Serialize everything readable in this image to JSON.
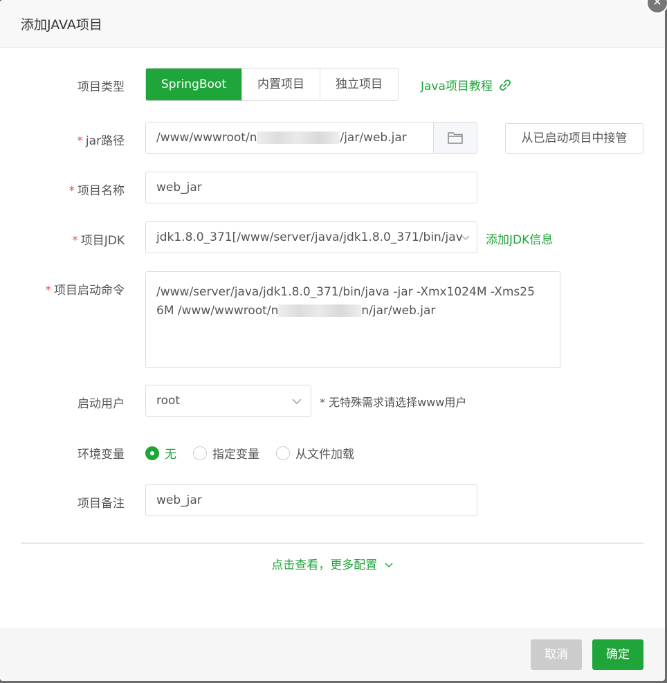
{
  "dialog": {
    "title": "添加JAVA项目",
    "close_icon": "close-icon"
  },
  "project_type": {
    "label": "项目类型",
    "options": [
      "SpringBoot",
      "内置项目",
      "独立项目"
    ],
    "selected": "SpringBoot",
    "tutorial_link": "Java项目教程",
    "link_icon": "link-icon"
  },
  "jar_path": {
    "label": "jar路径",
    "value_prefix": "/www/wwwroot/n",
    "value_suffix": "/jar/web.jar",
    "folder_icon": "folder-icon",
    "takeover_button": "从已启动项目中接管"
  },
  "project_name": {
    "label": "项目名称",
    "value": "web_jar"
  },
  "project_jdk": {
    "label": "项目JDK",
    "value": "jdk1.8.0_371[/www/server/java/jdk1.8.0_371/bin/jav",
    "add_link": "添加JDK信息"
  },
  "start_command": {
    "label": "项目启动命令",
    "line1": "/www/server/java/jdk1.8.0_371/bin/java -jar  -Xmx1024M -Xms25",
    "line2_prefix": "6M /www/wwwroot/n",
    "line2_suffix": "n/jar/web.jar"
  },
  "start_user": {
    "label": "启动用户",
    "value": "root",
    "hint": "* 无特殊需求请选择www用户"
  },
  "env_vars": {
    "label": "环境变量",
    "options": [
      "无",
      "指定变量",
      "从文件加载"
    ],
    "selected": "无"
  },
  "remark": {
    "label": "项目备注",
    "value": "web_jar"
  },
  "more_config": "点击查看，更多配置",
  "footer": {
    "cancel": "取消",
    "confirm": "确定"
  },
  "colors": {
    "accent": "#20a53a",
    "required": "#f04848"
  }
}
